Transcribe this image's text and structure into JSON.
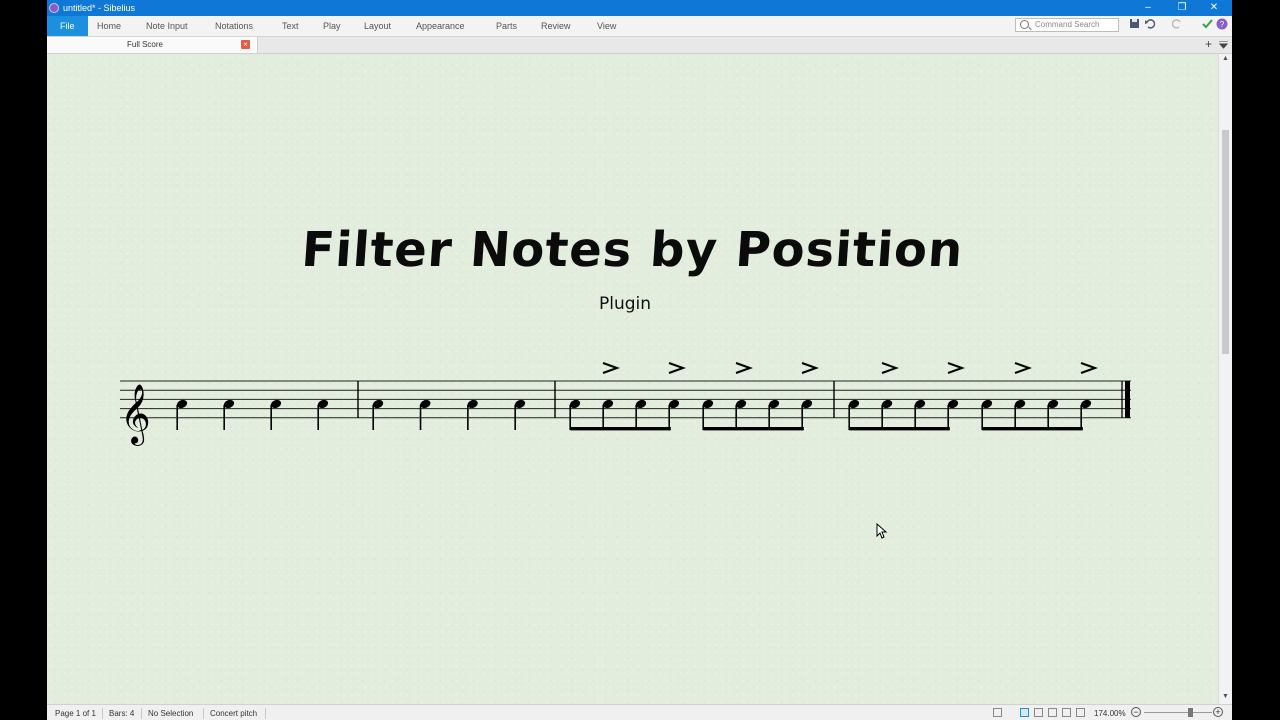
{
  "window": {
    "title": "untitled* - Sibelius",
    "minimize": "–",
    "restore": "❐",
    "close": "✕"
  },
  "ribbon": {
    "tabs": [
      "File",
      "Home",
      "Note Input",
      "Notations",
      "Text",
      "Play",
      "Layout",
      "Appearance",
      "Parts",
      "Review",
      "View"
    ],
    "command_search_placeholder": "Command Search"
  },
  "document_tab": {
    "label": "Full Score",
    "close": "×",
    "add": "+"
  },
  "score": {
    "title": "Filter Notes by Position",
    "subtitle": "Plugin",
    "clef": "𝄞",
    "bars": [
      {
        "type": "quarters",
        "count": 4,
        "accents": false
      },
      {
        "type": "quarters",
        "count": 4,
        "accents": false
      },
      {
        "type": "eighths",
        "count": 8,
        "accents": true
      },
      {
        "type": "eighths",
        "count": 8,
        "accents": true
      }
    ]
  },
  "status": {
    "page": "Page 1 of 1",
    "bars": "Bars: 4",
    "selection": "No Selection",
    "pitch": "Concert pitch",
    "zoom": "174.00%",
    "zoom_out": "−",
    "zoom_in": "+"
  },
  "colors": {
    "titlebar": "#0f78d7",
    "file_tab": "#1c8fde",
    "paper": "#e3eddd"
  }
}
